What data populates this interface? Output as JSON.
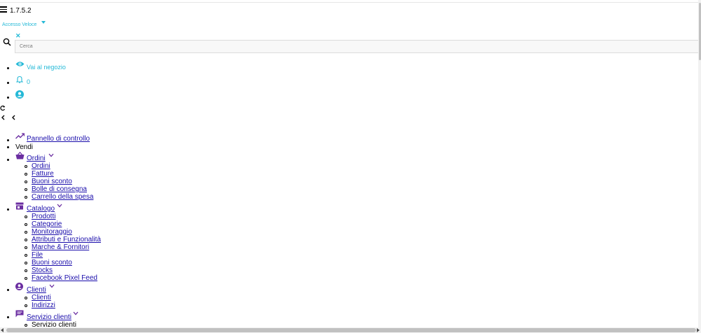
{
  "header": {
    "version": "1.7.5.2",
    "quick_access": "Accesso Veloce",
    "search_placeholder": "Cerca",
    "links": [
      {
        "label": "Vai al negozio",
        "icon": "eye-icon"
      },
      {
        "label": "0",
        "icon": "bell-icon"
      },
      {
        "label": "",
        "icon": "user-icon"
      }
    ]
  },
  "colors": {
    "accent": "#25b9d7",
    "icon": "#6b2ea1",
    "link": "#1a0dab"
  },
  "nav": {
    "dashboard": "Pannello di controllo",
    "section_sell": "Vendi",
    "groups": [
      {
        "label": "Ordini",
        "icon": "basket-icon",
        "items": [
          "Ordini",
          "Fatture",
          "Buoni sconto",
          "Bolle di consegna",
          "Carrello della spesa"
        ]
      },
      {
        "label": "Catalogo",
        "icon": "store-icon",
        "items": [
          "Prodotti",
          "Categorie",
          "Monitoraggio",
          "Attributi e Funzionalità",
          "Marche & Fornitori",
          "File",
          "Buoni sconto",
          "Stocks",
          "Facebook Pixel Feed"
        ]
      },
      {
        "label": "Clienti",
        "icon": "user-icon",
        "items": [
          "Clienti",
          "Indirizzi"
        ]
      },
      {
        "label": "Servizio clienti",
        "icon": "chat-icon",
        "items": [
          "Servizio clienti"
        ]
      }
    ]
  }
}
